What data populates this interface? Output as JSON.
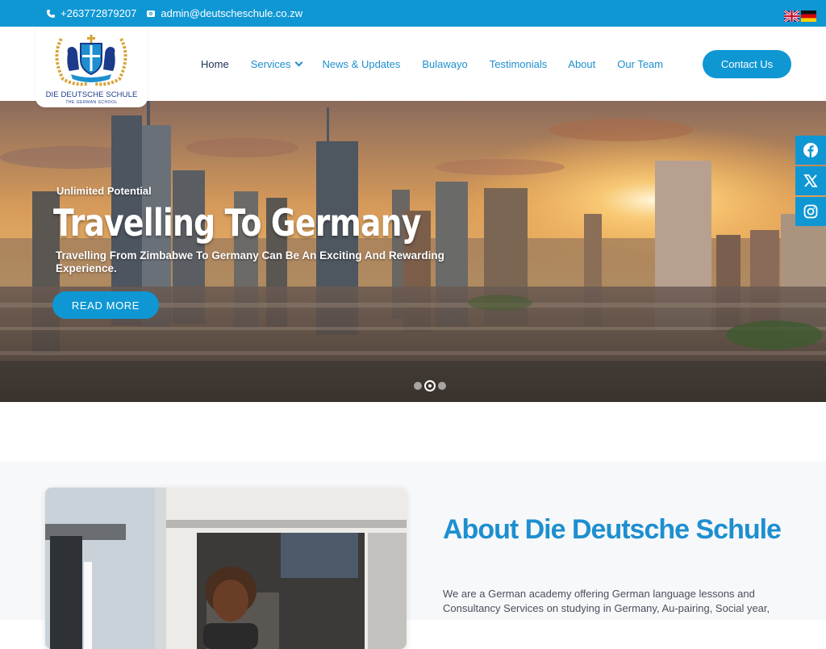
{
  "topbar": {
    "phone": "+263772879207",
    "email": "admin@deutscheschule.co.zw",
    "phone_icon": "phone-icon",
    "email_icon": "mail-icon",
    "flags": [
      "uk-flag-icon",
      "germany-flag-icon"
    ]
  },
  "logo": {
    "name": "DIE DEUTSCHE SCHULE",
    "tagline": "THE GERMAN SCHOOL"
  },
  "nav": {
    "items": [
      {
        "label": "Home",
        "active": true
      },
      {
        "label": "Services",
        "dropdown": true
      },
      {
        "label": "News & Updates"
      },
      {
        "label": "Bulawayo"
      },
      {
        "label": "Testimonials"
      },
      {
        "label": "About"
      },
      {
        "label": "Our Team"
      }
    ],
    "contact_button": "Contact Us"
  },
  "hero": {
    "eyebrow": "Unlimited Potential",
    "title": "Travelling To Germany",
    "subtitle": "Travelling From Zimbabwe To Germany Can Be An Exciting And Rewarding Experience.",
    "button": "READ MORE",
    "slides": 3,
    "active_slide": 2
  },
  "social": [
    "facebook-icon",
    "x-icon",
    "instagram-icon"
  ],
  "about": {
    "title": "About Die Deutsche Schule",
    "text": "We are a German academy offering German language lessons and Consultancy Services on studying in Germany, Au-pairing, Social year,"
  },
  "colors": {
    "accent": "#0f97d4",
    "nav_active": "#1c2e55",
    "link": "#1d8fcf"
  }
}
